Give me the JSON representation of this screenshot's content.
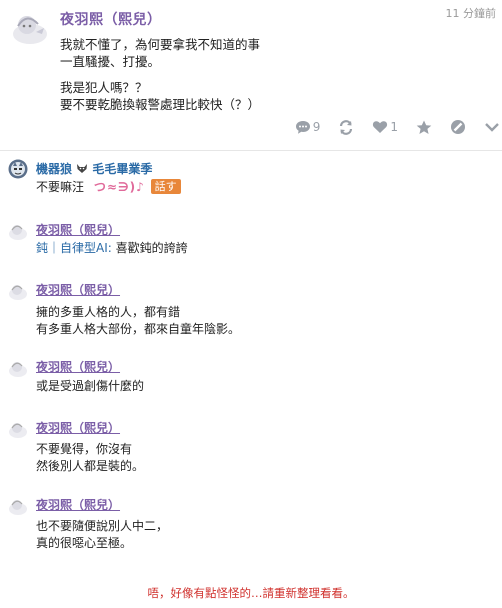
{
  "post": {
    "author": "夜羽熙（熙兒）",
    "time": "11 分鐘前",
    "paragraphs": [
      [
        "我就不懂了，為何要拿我不知道的事",
        "一直騷擾、打擾。"
      ],
      [
        "我是犯人嗎？？",
        "要不要乾脆換報警處理比較快（？）"
      ]
    ],
    "actions": {
      "comment_count": "9",
      "like_count": "1"
    }
  },
  "comments": [
    {
      "author": "機器狼",
      "author_extra": "毛毛畢業季",
      "avatar": "wolf-avatar",
      "text_prefix": "不要嘛汪",
      "decoration": "つ≈∋)♪",
      "tag": "話す"
    },
    {
      "author": "夜羽熙（熙兒）",
      "text_link": "鈍｜自律型AI:",
      "text_rest": " 喜歡鈍的誇誇"
    },
    {
      "author": "夜羽熙（熙兒）",
      "lines": [
        "擁的多重人格的人，都有錯",
        "有多重人格大部份，都來自童年陰影。"
      ]
    },
    {
      "author": "夜羽熙（熙兒）",
      "lines": [
        "或是受過創傷什麼的"
      ]
    },
    {
      "author": "夜羽熙（熙兒）",
      "lines": [
        "不要覺得，你沒有",
        "然後別人都是裝的。"
      ]
    },
    {
      "author": "夜羽熙（熙兒）",
      "lines": [
        "也不要隨便說別人中二，",
        "真的很噁心至極。"
      ]
    }
  ],
  "footer_message": "唔，好像有點怪怪的…請重新整理看看。",
  "colors": {
    "author": "#7b5ea7",
    "link": "#2a6aa6",
    "tag": "#e8873a",
    "error": "#d0312d",
    "icon": "#9aa0a8"
  }
}
